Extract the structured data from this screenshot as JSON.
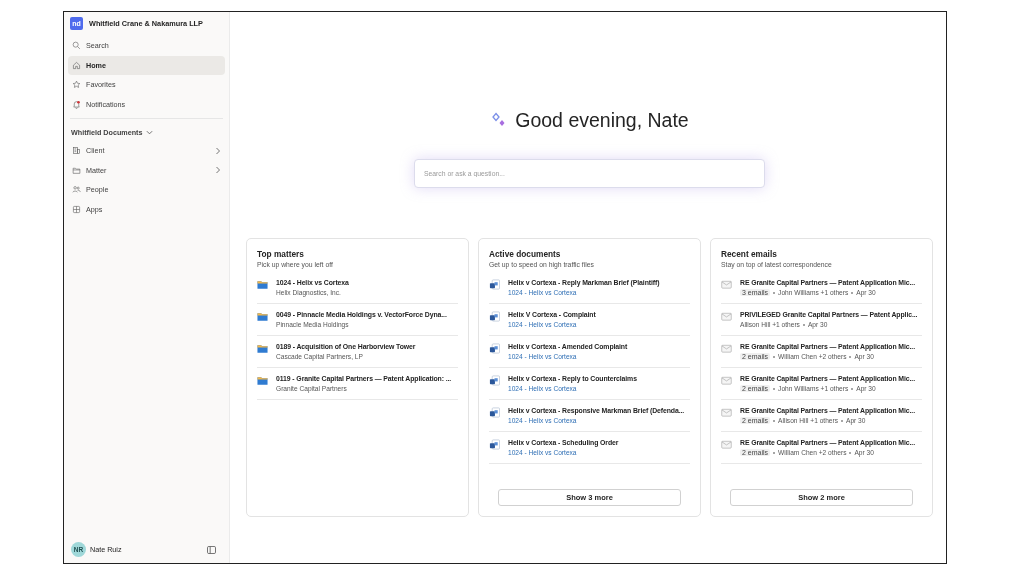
{
  "sidebar": {
    "logo": "nd",
    "org_name": "Whitfield Crane & Nakamura LLP",
    "nav": [
      {
        "label": "Search",
        "selected": false
      },
      {
        "label": "Home",
        "selected": true
      },
      {
        "label": "Favorites",
        "selected": false
      },
      {
        "label": "Notifications",
        "selected": false
      }
    ],
    "section": {
      "title": "Whitfield Documents",
      "expanded": true,
      "items": [
        {
          "label": "Client",
          "has_children": true
        },
        {
          "label": "Matter",
          "has_children": true
        },
        {
          "label": "People",
          "has_children": false
        },
        {
          "label": "Apps",
          "has_children": false
        }
      ]
    },
    "user": {
      "initials": "NR",
      "name": "Nate Ruiz"
    }
  },
  "greeting": "Good evening, Nate",
  "search": {
    "placeholder": "Search or ask a question..."
  },
  "cards": [
    {
      "kind": "matters",
      "title": "Top matters",
      "subtitle": "Pick up where you left off",
      "items": [
        {
          "title": "1024 - Helix vs Cortexa",
          "sub": "Helix Diagnostics, Inc."
        },
        {
          "title": "0049 - Pinnacle Media Holdings v. VectorForce Dyna...",
          "sub": "Pinnacle Media Holdings"
        },
        {
          "title": "0189 - Acquisition of One Harborview Tower",
          "sub": "Cascade Capital Partners, LP"
        },
        {
          "title": "0119 - Granite Capital Partners — Patent Application: ...",
          "sub": "Granite Capital Partners"
        }
      ]
    },
    {
      "kind": "documents",
      "title": "Active documents",
      "subtitle": "Get up to speed on high traffic files",
      "items": [
        {
          "title": "Helix v Cortexa - Reply Markman Brief (Plaintiff)",
          "sub": "1024 - Helix vs Cortexa"
        },
        {
          "title": "Helix V Cortexa - Complaint",
          "sub": "1024 - Helix vs Cortexa"
        },
        {
          "title": "Helix v Cortexa - Amended Complaint",
          "sub": "1024 - Helix vs Cortexa"
        },
        {
          "title": "Helix v Cortexa - Reply to Counterclaims",
          "sub": "1024 - Helix vs Cortexa"
        },
        {
          "title": "Helix v Cortexa - Responsive Markman Brief (Defenda...",
          "sub": "1024 - Helix vs Cortexa"
        },
        {
          "title": "Helix v Cortexa - Scheduling Order",
          "sub": "1024 - Helix vs Cortexa"
        }
      ],
      "more": "Show 3 more"
    },
    {
      "kind": "emails",
      "title": "Recent emails",
      "subtitle": "Stay on top of latest correspondence",
      "items": [
        {
          "title": "RE Granite Capital Partners — Patent Application Mic...",
          "count": "3 emails",
          "people": "John Williams +1 others",
          "date": "Apr 30"
        },
        {
          "title": "PRIVILEGED Granite Capital Partners — Patent Applic...",
          "people": "Allison Hill +1 others",
          "date": "Apr 30"
        },
        {
          "title": "RE Granite Capital Partners — Patent Application Mic...",
          "count": "2 emails",
          "people": "William Chen +2 others",
          "date": "Apr 30"
        },
        {
          "title": "RE Granite Capital Partners — Patent Application Mic...",
          "count": "2 emails",
          "people": "John Williams +1 others",
          "date": "Apr 30"
        },
        {
          "title": "RE Granite Capital Partners — Patent Application Mic...",
          "count": "2 emails",
          "people": "Allison Hill +1 others",
          "date": "Apr 30"
        },
        {
          "title": "RE Granite Capital Partners — Patent Application Mic...",
          "count": "2 emails",
          "people": "William Chen +2 others",
          "date": "Apr 30"
        }
      ],
      "more": "Show 2 more"
    }
  ]
}
